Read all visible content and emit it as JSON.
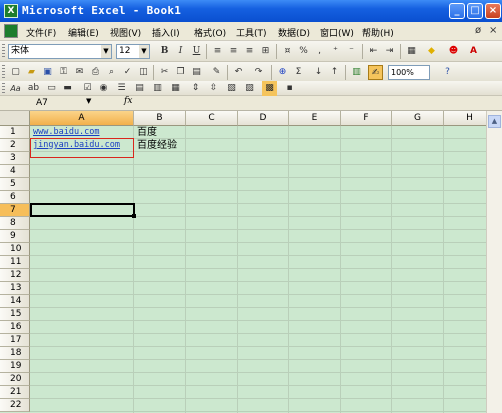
{
  "window": {
    "title": "Microsoft Excel - Book1",
    "title_glyph": "X",
    "controls": {
      "minimize": "_",
      "maximize": "□",
      "close": "×"
    }
  },
  "menubar": {
    "items": [
      "文件(F)",
      "编辑(E)",
      "视图(V)",
      "插入(I)",
      "格式(O)",
      "工具(T)",
      "数据(D)",
      "窗口(W)",
      "帮助(H)"
    ],
    "restore_glyph": "ø",
    "close_glyph": "×"
  },
  "formatting_toolbar": {
    "font_name": "宋体",
    "font_size": "12",
    "bold": "B",
    "italic": "I",
    "underline": "U",
    "percent": "%",
    "comma": ","
  },
  "standard_toolbar": {
    "sum": "Σ",
    "zoom": "100%"
  },
  "formula_bar": {
    "name_box": "A7",
    "fx": "fx"
  },
  "sheet": {
    "columns": [
      "A",
      "B",
      "C",
      "D",
      "E",
      "F",
      "G",
      "H"
    ],
    "selected_column": "A",
    "rows": [
      "1",
      "2",
      "3",
      "4",
      "5",
      "6",
      "7",
      "8",
      "9",
      "10",
      "11",
      "12",
      "13",
      "14",
      "15",
      "16",
      "17",
      "18",
      "19",
      "20",
      "21",
      "22"
    ],
    "selected_row": "7",
    "cells": {
      "A1": "www.baidu.com",
      "B1": "百度",
      "A2": "jingyan.baidu.com",
      "B2": "百度经验"
    }
  },
  "colors": {
    "titlebar": "#1560e0",
    "grid_background": "#cce8cf",
    "hyperlink": "#1b3fc2",
    "highlight_box": "#d9261c",
    "selected_header": "#f6be5a"
  }
}
